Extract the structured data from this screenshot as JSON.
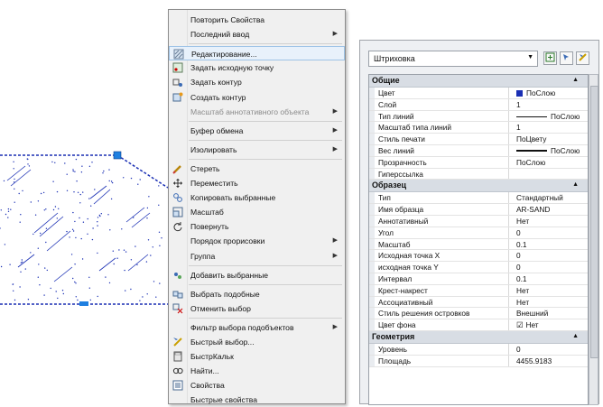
{
  "menu": {
    "items": [
      {
        "label": "Повторить Свойства",
        "icon": "",
        "submenu": false,
        "disabled": false
      },
      {
        "label": "Последний ввод",
        "icon": "",
        "submenu": true,
        "disabled": false
      },
      {
        "sep": true
      },
      {
        "label": "Редактирование...",
        "icon": "hatch-edit-icon",
        "submenu": false,
        "disabled": false,
        "highlight": true
      },
      {
        "label": "Задать исходную точку",
        "icon": "origin-point-icon",
        "submenu": false,
        "disabled": false
      },
      {
        "label": "Задать контур",
        "icon": "boundary-icon",
        "submenu": false,
        "disabled": false
      },
      {
        "label": "Создать контур",
        "icon": "create-boundary-icon",
        "submenu": false,
        "disabled": false
      },
      {
        "label": "Масштаб аннотативного объекта",
        "icon": "",
        "submenu": true,
        "disabled": true
      },
      {
        "sep": true
      },
      {
        "label": "Буфер обмена",
        "icon": "",
        "submenu": true,
        "disabled": false
      },
      {
        "sep": true
      },
      {
        "label": "Изолировать",
        "icon": "",
        "submenu": true,
        "disabled": false
      },
      {
        "sep": true
      },
      {
        "label": "Стереть",
        "icon": "erase-icon",
        "submenu": false,
        "disabled": false
      },
      {
        "label": "Переместить",
        "icon": "move-icon",
        "submenu": false,
        "disabled": false
      },
      {
        "label": "Копировать выбранные",
        "icon": "copy-icon",
        "submenu": false,
        "disabled": false
      },
      {
        "label": "Масштаб",
        "icon": "scale-icon",
        "submenu": false,
        "disabled": false
      },
      {
        "label": "Повернуть",
        "icon": "rotate-icon",
        "submenu": false,
        "disabled": false
      },
      {
        "label": "Порядок прорисовки",
        "icon": "",
        "submenu": true,
        "disabled": false
      },
      {
        "label": "Группа",
        "icon": "",
        "submenu": true,
        "disabled": false
      },
      {
        "sep": true
      },
      {
        "label": "Добавить выбранные",
        "icon": "add-selected-icon",
        "submenu": false,
        "disabled": false
      },
      {
        "sep": true
      },
      {
        "label": "Выбрать подобные",
        "icon": "select-similar-icon",
        "submenu": false,
        "disabled": false
      },
      {
        "label": "Отменить выбор",
        "icon": "deselect-icon",
        "submenu": false,
        "disabled": false
      },
      {
        "sep": true
      },
      {
        "label": "Фильтр выбора подобъектов",
        "icon": "",
        "submenu": true,
        "disabled": false
      },
      {
        "label": "Быстрый выбор...",
        "icon": "quick-select-icon",
        "submenu": false,
        "disabled": false
      },
      {
        "label": "БыстрКальк",
        "icon": "calculator-icon",
        "submenu": false,
        "disabled": false
      },
      {
        "label": "Найти...",
        "icon": "find-icon",
        "submenu": false,
        "disabled": false
      },
      {
        "label": "Свойства",
        "icon": "properties-icon",
        "submenu": false,
        "disabled": false
      },
      {
        "label": "Быстрые свойства",
        "icon": "",
        "submenu": false,
        "disabled": false
      }
    ]
  },
  "palette": {
    "object_type": "Штриховка",
    "categories": [
      {
        "name": "Общие",
        "rows": [
          {
            "k": "Цвет",
            "v": "ПоСлою",
            "swatch": "#1a2fb4"
          },
          {
            "k": "Слой",
            "v": "1"
          },
          {
            "k": "Тип линий",
            "v": "ПоСлою",
            "line": "thin"
          },
          {
            "k": "Масштаб типа линий",
            "v": "1"
          },
          {
            "k": "Стиль печати",
            "v": "ПоЦвету"
          },
          {
            "k": "Вес линий",
            "v": "ПоСлою",
            "line": "thick"
          },
          {
            "k": "Прозрачность",
            "v": "ПоСлою"
          },
          {
            "k": "Гиперссылка",
            "v": ""
          }
        ]
      },
      {
        "name": "Образец",
        "rows": [
          {
            "k": "Тип",
            "v": "Стандартный"
          },
          {
            "k": "Имя образца",
            "v": "AR-SAND"
          },
          {
            "k": "Аннотативный",
            "v": "Нет"
          },
          {
            "k": "Угол",
            "v": "0"
          },
          {
            "k": "Масштаб",
            "v": "0.1"
          },
          {
            "k": "Исходная точка X",
            "v": "0"
          },
          {
            "k": "исходная точка Y",
            "v": "0"
          },
          {
            "k": "Интервал",
            "v": "0.1"
          },
          {
            "k": "Крест-накрест",
            "v": "Нет"
          },
          {
            "k": "Ассоциативный",
            "v": "Нет"
          },
          {
            "k": "Стиль решения островков",
            "v": "Внешний"
          },
          {
            "k": "Цвет фона",
            "v": "Нет",
            "checkbox": true
          }
        ]
      },
      {
        "name": "Геометрия",
        "rows": [
          {
            "k": "Уровень",
            "v": "0"
          },
          {
            "k": "Площадь",
            "v": "4455.9183"
          }
        ]
      }
    ]
  },
  "colors": {
    "hatch": "#1a2fb4",
    "grip": "#1e7fe0",
    "menu_highlight": "#e8f1fb"
  }
}
